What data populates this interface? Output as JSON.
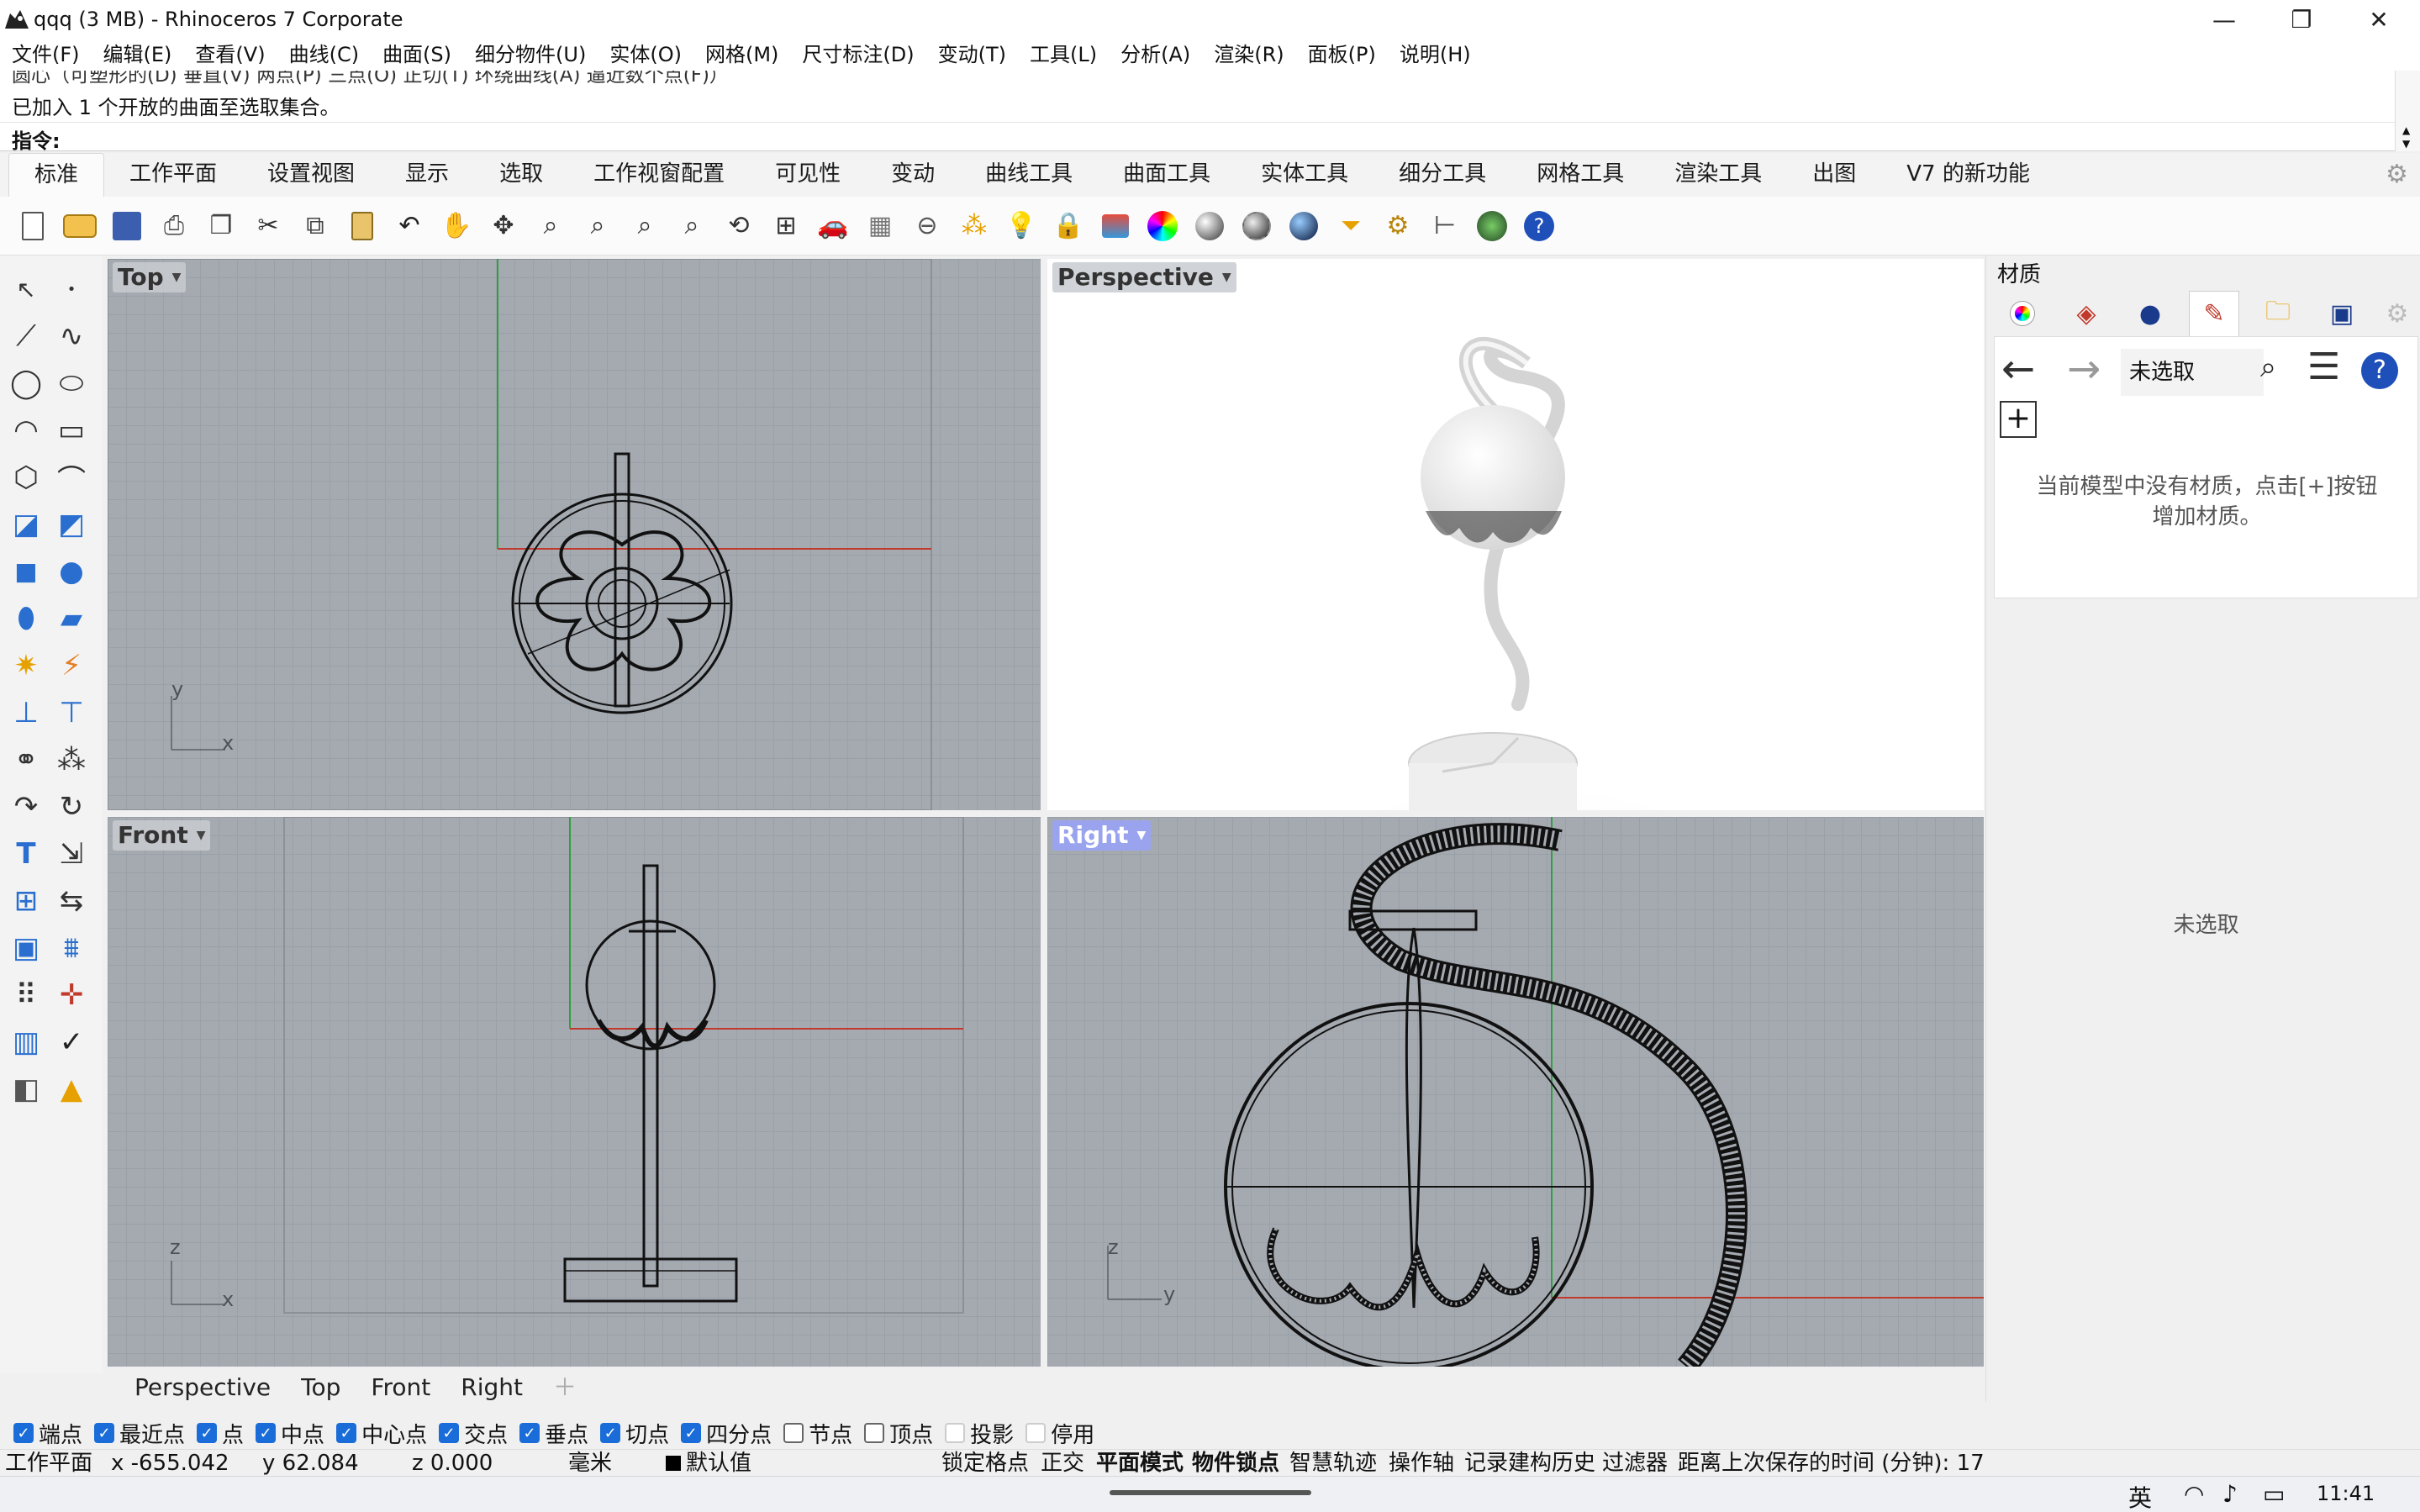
{
  "window": {
    "title": "qqq (3 MB) - Rhinoceros 7 Corporate",
    "minimize": "—",
    "maximize": "❐",
    "close": "✕"
  },
  "menu": [
    "文件(F)",
    "编辑(E)",
    "查看(V)",
    "曲线(C)",
    "曲面(S)",
    "细分物件(U)",
    "实体(O)",
    "网格(M)",
    "尺寸标注(D)",
    "变动(T)",
    "工具(L)",
    "分析(A)",
    "渲染(R)",
    "面板(P)",
    "说明(H)"
  ],
  "command": {
    "history_line1": "圆心（可塑形的(D)  垂直(V)  两点(P)  三点(O)  正切(T)  环绕曲线(A)  逼近数个点(F)）",
    "history_line2": "已加入 1 个开放的曲面至选取集合。",
    "prompt_label": "指令:",
    "input_value": ""
  },
  "tabs": [
    "标准",
    "工作平面",
    "设置视图",
    "显示",
    "选取",
    "工作视窗配置",
    "可见性",
    "变动",
    "曲线工具",
    "曲面工具",
    "实体工具",
    "细分工具",
    "网格工具",
    "渲染工具",
    "出图",
    "V7 的新功能"
  ],
  "active_tab": "标准",
  "viewports": {
    "top": {
      "label": "Top",
      "axis_a": "y",
      "axis_b": "x"
    },
    "perspective": {
      "label": "Perspective"
    },
    "front": {
      "label": "Front",
      "axis_a": "z",
      "axis_b": "x"
    },
    "right": {
      "label": "Right",
      "axis_a": "z",
      "axis_b": "y"
    }
  },
  "viewport_tabs": [
    "Perspective",
    "Top",
    "Front",
    "Right"
  ],
  "osnaps": [
    {
      "label": "端点",
      "checked": true
    },
    {
      "label": "最近点",
      "checked": true
    },
    {
      "label": "点",
      "checked": true
    },
    {
      "label": "中点",
      "checked": true
    },
    {
      "label": "中心点",
      "checked": true
    },
    {
      "label": "交点",
      "checked": true
    },
    {
      "label": "垂点",
      "checked": true
    },
    {
      "label": "切点",
      "checked": true
    },
    {
      "label": "四分点",
      "checked": true
    },
    {
      "label": "节点",
      "checked": false
    },
    {
      "label": "顶点",
      "checked": false
    },
    {
      "label": "投影",
      "checked": false
    },
    {
      "label": "停用",
      "checked": false
    }
  ],
  "status": {
    "cplane": "工作平面",
    "x": "x -655.042",
    "y": "y 62.084",
    "z": "z 0.000",
    "units": "毫米",
    "layer": "默认值",
    "grid_snap": "锁定格点",
    "ortho": "正交",
    "planar": "平面模式",
    "osnap": "物件锁点",
    "smarttrack": "智慧轨迹",
    "gumball": "操作轴",
    "history": "记录建构历史",
    "filter": "过滤器",
    "save_time": "距离上次保存的时间 (分钟): 17"
  },
  "panel": {
    "title": "材质",
    "selection": "未选取",
    "empty_message_line1": "当前模型中没有材质，点击[+]按钮",
    "empty_message_line2": "增加材质。",
    "bottom_selection": "未选取"
  },
  "taskbar": {
    "ime": "英",
    "time": "11:41"
  },
  "colors": {
    "viewport_grid": "#a5aab1",
    "active_label": "#9aa4ee",
    "checkbox": "#1a6dd8"
  }
}
